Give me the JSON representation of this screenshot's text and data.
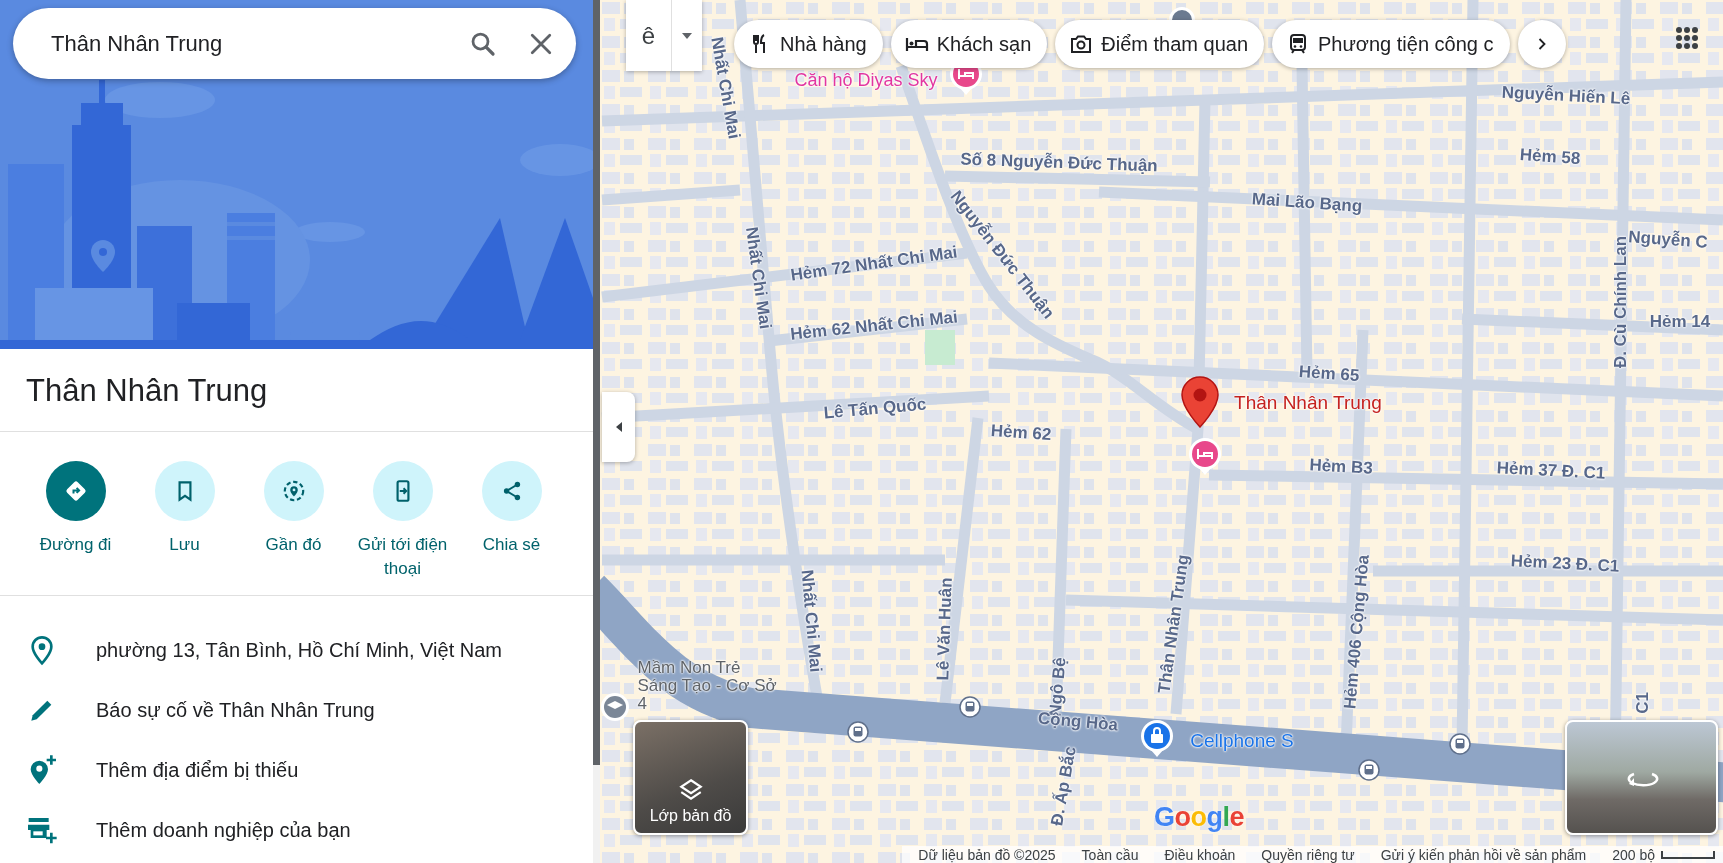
{
  "search": {
    "value": "Thân Nhân Trung"
  },
  "place": {
    "title": "Thân Nhân Trung"
  },
  "actions": [
    {
      "kind": "directions",
      "label": "Đường đi"
    },
    {
      "kind": "save",
      "label": "Lưu"
    },
    {
      "kind": "nearby",
      "label": "Gần đó"
    },
    {
      "kind": "send",
      "label": "Gửi tới điện thoại"
    },
    {
      "kind": "share",
      "label": "Chia sẻ"
    }
  ],
  "info_items": [
    {
      "kind": "address",
      "text": "phường 13, Tân Bình, Hồ Chí Minh, Việt Nam"
    },
    {
      "kind": "edit",
      "text": "Báo sự cố về Thân Nhân Trung"
    },
    {
      "kind": "add-place",
      "text": "Thêm địa điểm bị thiếu"
    },
    {
      "kind": "add-business",
      "text": "Thêm doanh nghiệp của bạn"
    }
  ],
  "map": {
    "input_tool": {
      "label": "ê"
    },
    "chips": [
      {
        "kind": "restaurant",
        "label": "Nhà hàng"
      },
      {
        "kind": "hotel",
        "label": "Khách sạn"
      },
      {
        "kind": "attraction",
        "label": "Điểm tham quan"
      },
      {
        "kind": "transit",
        "label": "Phương tiện công c"
      }
    ],
    "labels": [
      {
        "kind": "poi",
        "text": "Căn hộ Diyas Sky"
      },
      {
        "kind": "street",
        "text": "Nhất Chi Mai"
      },
      {
        "kind": "street",
        "text": "Nguyễn Hiến Lê"
      },
      {
        "kind": "street",
        "text": "Số 8 Nguyễn Đức Thuận"
      },
      {
        "kind": "street",
        "text": "Mai Lão Bạng"
      },
      {
        "kind": "street",
        "text": "Hẻm 58"
      },
      {
        "kind": "street",
        "text": "Nguyễn Đức Thuận"
      },
      {
        "kind": "street",
        "text": "Nhất Chi Mai"
      },
      {
        "kind": "street",
        "text": "Hẻm 72 Nhất Chi Mai"
      },
      {
        "kind": "street",
        "text": "Hẻm 62 Nhất Chi Mai"
      },
      {
        "kind": "street",
        "text": "Nguyễn C"
      },
      {
        "kind": "street",
        "text": "Đ. Cù Chính Lan"
      },
      {
        "kind": "street",
        "text": "Hẻm 14"
      },
      {
        "kind": "street",
        "text": "Hẻm 65"
      },
      {
        "kind": "street",
        "text": "Lê Tấn Quốc"
      },
      {
        "kind": "street",
        "text": "Hẻm 62"
      },
      {
        "kind": "pin",
        "text": "Thân Nhân Trung"
      },
      {
        "kind": "street",
        "text": "Hẻm B3"
      },
      {
        "kind": "street",
        "text": "Hẻm 37 Đ. C1"
      },
      {
        "kind": "street",
        "text": "Hẻm 23 Đ. C1"
      },
      {
        "kind": "street",
        "text": "Nhất Chi Mai"
      },
      {
        "kind": "street",
        "text": "Lê Văn Huân"
      },
      {
        "kind": "street",
        "text": "Ngô Bệ"
      },
      {
        "kind": "street",
        "text": "Thân Nhân Trung"
      },
      {
        "kind": "street",
        "text": "Hẻm 406 Cộng Hòa"
      },
      {
        "kind": "street",
        "text": "Cộng Hòa"
      },
      {
        "kind": "shop",
        "text": "Cellphone S"
      },
      {
        "kind": "school",
        "text": "Mầm Non Trẻ Sáng Tạo - Cơ Sở 4"
      },
      {
        "kind": "street",
        "text": "Đ. Ấp Bắc"
      },
      {
        "kind": "street",
        "text": "C1"
      }
    ],
    "layers_button": {
      "label": "Lớp bản đồ"
    },
    "logo": "Google",
    "footer": [
      "Dữ liệu bản đồ ©2025",
      "Toàn cầu",
      "Điều khoản",
      "Quyền riêng tư",
      "Gửi ý kiến phản hồi về sản phẩm"
    ],
    "scale": "200 bộ"
  }
}
